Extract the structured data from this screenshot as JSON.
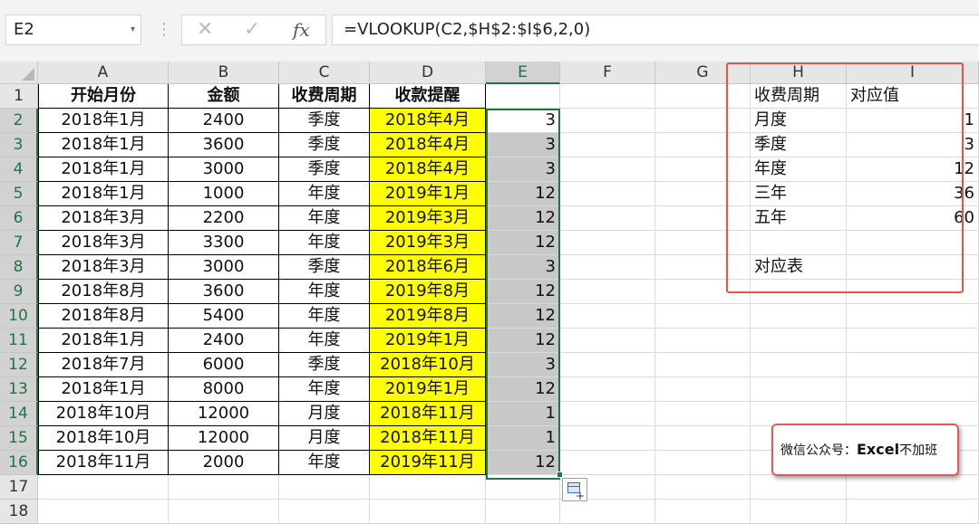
{
  "formula_bar": {
    "name_box": "E2",
    "name_box_dropdown": "▾",
    "separator": "⋮",
    "cancel": "✕",
    "enter": "✓",
    "fx": "fx",
    "formula": "=VLOOKUP(C2,$H$2:$I$6,2,0)"
  },
  "columns": [
    "A",
    "B",
    "C",
    "D",
    "E",
    "F",
    "G",
    "H",
    "I"
  ],
  "selected_column": "E",
  "header_row": [
    "开始月份",
    "金额",
    "收费周期",
    "收款提醒",
    ""
  ],
  "rows": [
    [
      "2018年1月",
      "2400",
      "季度",
      "2018年4月",
      "3"
    ],
    [
      "2018年1月",
      "3600",
      "季度",
      "2018年4月",
      "3"
    ],
    [
      "2018年1月",
      "3000",
      "季度",
      "2018年4月",
      "3"
    ],
    [
      "2018年1月",
      "1000",
      "年度",
      "2019年1月",
      "12"
    ],
    [
      "2018年3月",
      "2200",
      "年度",
      "2019年3月",
      "12"
    ],
    [
      "2018年3月",
      "3300",
      "年度",
      "2019年3月",
      "12"
    ],
    [
      "2018年3月",
      "3000",
      "季度",
      "2018年6月",
      "3"
    ],
    [
      "2018年8月",
      "3600",
      "年度",
      "2019年8月",
      "12"
    ],
    [
      "2018年8月",
      "5400",
      "年度",
      "2019年8月",
      "12"
    ],
    [
      "2018年1月",
      "2400",
      "年度",
      "2019年1月",
      "12"
    ],
    [
      "2018年7月",
      "6000",
      "季度",
      "2018年10月",
      "3"
    ],
    [
      "2018年1月",
      "8000",
      "年度",
      "2019年1月",
      "12"
    ],
    [
      "2018年10月",
      "12000",
      "月度",
      "2018年11月",
      "1"
    ],
    [
      "2018年10月",
      "12000",
      "月度",
      "2018年11月",
      "1"
    ],
    [
      "2018年11月",
      "2000",
      "年度",
      "2019年11月",
      "12"
    ]
  ],
  "lookup_table": {
    "header": [
      "收费周期",
      "对应值"
    ],
    "rows": [
      [
        "月度",
        "1"
      ],
      [
        "季度",
        "3"
      ],
      [
        "年度",
        "12"
      ],
      [
        "三年",
        "36"
      ],
      [
        "五年",
        "60"
      ]
    ],
    "label": "对应表"
  },
  "watermark": {
    "prefix": "微信公众号：",
    "brand": "Excel",
    "suffix": "不加班"
  },
  "colors": {
    "highlight_yellow": "#ffff00",
    "selection_gray": "#c8c8c8",
    "selection_border": "#217346",
    "annotation_red": "#e8534a"
  }
}
